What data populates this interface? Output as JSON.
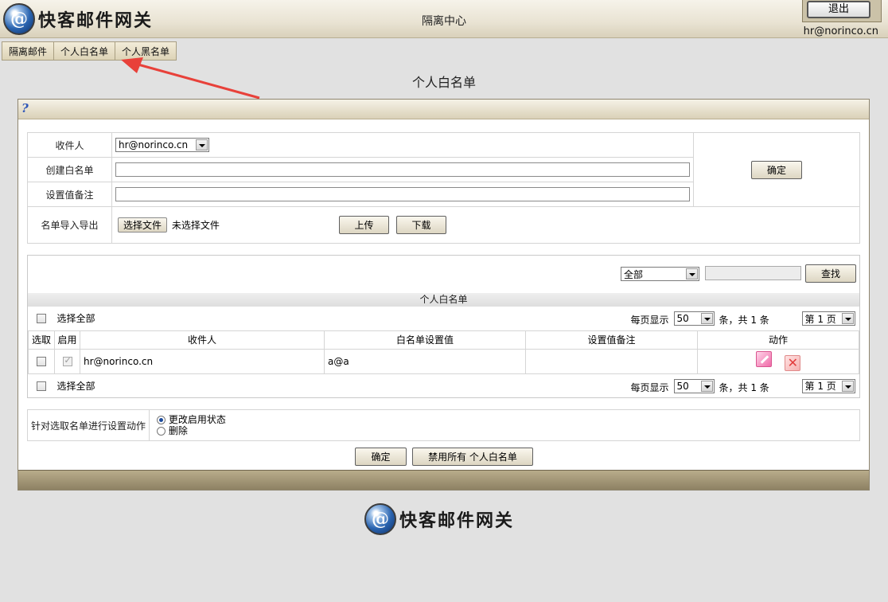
{
  "app": {
    "logo_text": "快客邮件网关",
    "header_title": "隔离中心",
    "exit_label": "退出",
    "user_email": "hr@norinco.cn"
  },
  "tabs": [
    {
      "label": "隔离邮件"
    },
    {
      "label": "个人白名单"
    },
    {
      "label": "个人黑名单"
    }
  ],
  "page_title": "个人白名单",
  "help_icon": "?",
  "form": {
    "recipient_label": "收件人",
    "recipient_value": "hr@norinco.cn",
    "create_label": "创建白名单",
    "create_value": "",
    "note_label": "设置值备注",
    "note_value": "",
    "confirm_label": "确定",
    "import_label": "名单导入导出",
    "choose_file_label": "选择文件",
    "no_file_text": "未选择文件",
    "upload_label": "上传",
    "download_label": "下载"
  },
  "list": {
    "filter_value": "全部",
    "search_value": "",
    "search_label": "查找",
    "title": "个人白名单",
    "select_all_label": "选择全部",
    "per_page_label": "每页显示",
    "per_page_value": "50",
    "count_text": "条，共 1 条",
    "page_value": "第 1 页",
    "columns": [
      "选取",
      "启用",
      "收件人",
      "白名单设置值",
      "设置值备注",
      "动作"
    ],
    "rows": [
      {
        "recipient": "hr@norinco.cn",
        "value": "a@a",
        "note": "",
        "enabled": true
      }
    ]
  },
  "action": {
    "label": "针对选取名单进行设置动作",
    "option_change": "更改启用状态",
    "option_delete": "删除",
    "confirm_label": "确定",
    "disable_all_label": "禁用所有 个人白名单"
  },
  "footer": {
    "logo_text": "快客邮件网关"
  },
  "colors": {
    "annotation_arrow": "#e8413a"
  }
}
